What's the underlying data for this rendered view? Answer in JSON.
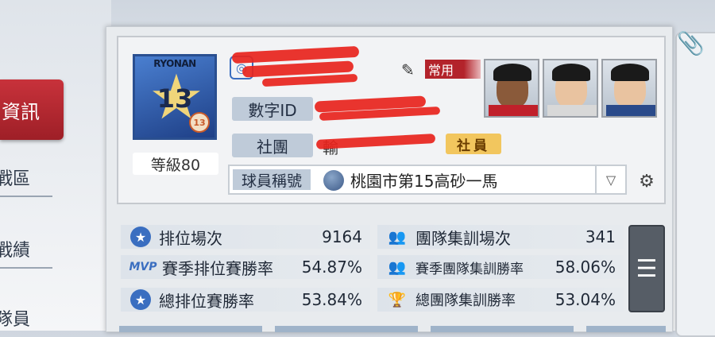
{
  "nav": {
    "active_label": "資訊",
    "items": [
      "戰區",
      "戰績",
      "隊員"
    ]
  },
  "profile": {
    "badge": {
      "team": "RYONAN",
      "number": "13",
      "sub": "13"
    },
    "level_label": "等級80",
    "id_label": "數字ID",
    "club_label": "社團",
    "club_value_visible": "輸",
    "common_tag": "常用",
    "member_tag": "社員",
    "title_label": "球員稱號",
    "title_value": "桃園市第15高砂一馬"
  },
  "stats": [
    {
      "icon": "star-icon",
      "name": "排位場次",
      "value": "9164"
    },
    {
      "icon": "mvp-icon",
      "name": "賽季排位賽勝率",
      "value": "54.87%"
    },
    {
      "icon": "star-icon",
      "name": "總排位賽勝率",
      "value": "53.84%"
    },
    {
      "icon": "team-icon",
      "name": "團隊集訓場次",
      "value": "341"
    },
    {
      "icon": "team-icon",
      "name": "賽季團隊集訓勝率",
      "value": "58.06%"
    },
    {
      "icon": "trophy-icon",
      "name": "總團隊集訓勝率",
      "value": "53.04%"
    }
  ],
  "mvp_text": "MVP",
  "colors": {
    "accent": "#3a6ec0",
    "nav_active": "#b3232b",
    "member_tag": "#f2c65e"
  }
}
